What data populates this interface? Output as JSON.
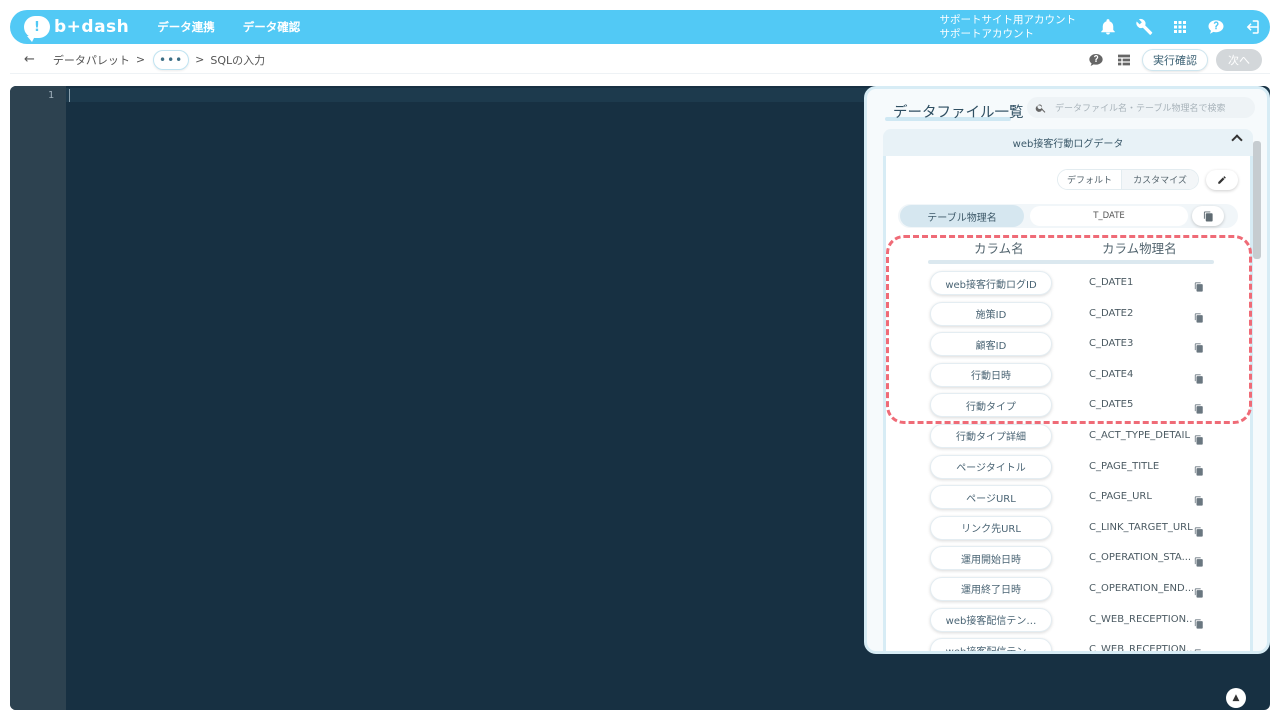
{
  "header": {
    "logo_text": "b+dash",
    "logo_mark": "!",
    "nav": [
      "データ連携",
      "データ確認"
    ],
    "account_line1": "サポートサイト用アカウント",
    "account_line2": "サポートアカウント",
    "icons": [
      "bell-icon",
      "wrench-icon",
      "apps-grid-icon",
      "help-chat-icon",
      "logout-icon"
    ],
    "brand_color": "#52c9f5"
  },
  "breadcrumb": {
    "back": "←",
    "first": "データパレット",
    "sep": ">",
    "more": "•••",
    "last": "SQLの入力"
  },
  "toolbar": {
    "run_label": "実行確認",
    "next_label": "次へ"
  },
  "editor": {
    "line_number": "1",
    "background": "#173042"
  },
  "panel": {
    "title": "データファイル一覧",
    "search_placeholder": "データファイル名・テーブル物理名で検索",
    "section_title": "web接客行動ログデータ",
    "seg_default": "デフォルト",
    "seg_custom": "カスタマイズ",
    "table_label": "テーブル物理名",
    "table_value": "T_DATE",
    "col_header_name": "カラム名",
    "col_header_phys": "カラム物理名",
    "columns": [
      {
        "name": "web接客行動ログID",
        "phys": "C_DATE1"
      },
      {
        "name": "施策ID",
        "phys": "C_DATE2"
      },
      {
        "name": "顧客ID",
        "phys": "C_DATE3"
      },
      {
        "name": "行動日時",
        "phys": "C_DATE4"
      },
      {
        "name": "行動タイプ",
        "phys": "C_DATE5"
      },
      {
        "name": "行動タイプ詳細",
        "phys": "C_ACT_TYPE_DETAIL"
      },
      {
        "name": "ページタイトル",
        "phys": "C_PAGE_TITLE"
      },
      {
        "name": "ページURL",
        "phys": "C_PAGE_URL"
      },
      {
        "name": "リンク先URL",
        "phys": "C_LINK_TARGET_URL"
      },
      {
        "name": "運用開始日時",
        "phys": "C_OPERATION_STA..."
      },
      {
        "name": "運用終了日時",
        "phys": "C_OPERATION_END..."
      },
      {
        "name": "web接客配信テン…",
        "phys": "C_WEB_RECEPTION..."
      },
      {
        "name": "web接客配信テン…",
        "phys": "C_WEB_RECEPTION..."
      }
    ],
    "highlight_color": "#ef6b77"
  }
}
